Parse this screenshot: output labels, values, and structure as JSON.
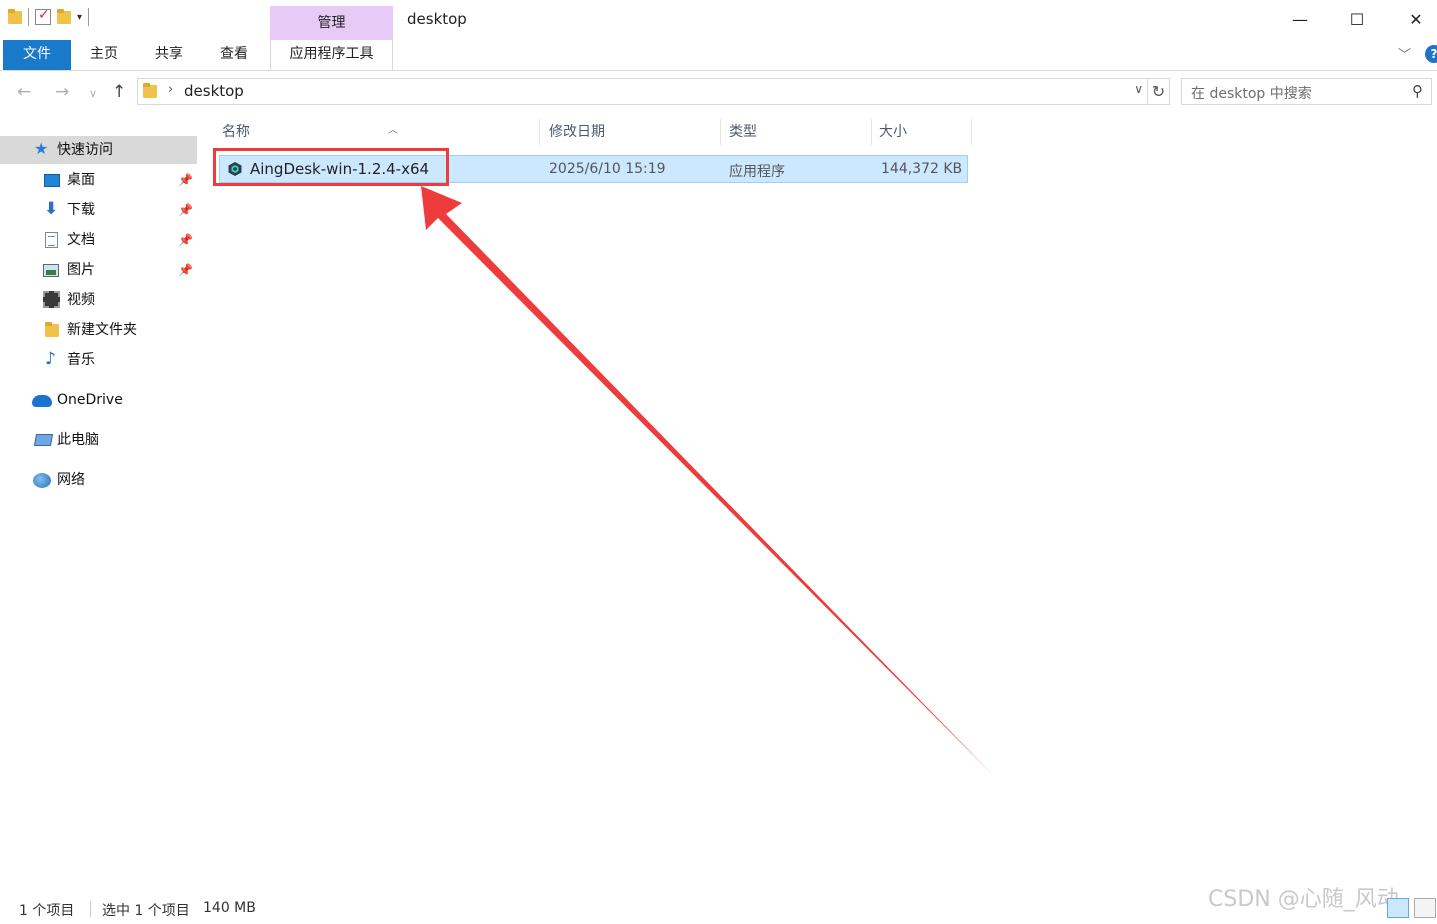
{
  "window": {
    "title": "desktop",
    "context_tab": "管理",
    "controls": {
      "minimize": "—",
      "maximize": "☐",
      "close": "✕"
    }
  },
  "ribbon": {
    "tabs": [
      "文件",
      "主页",
      "共享",
      "查看",
      "应用程序工具"
    ],
    "expand_icon": "chevron-down-icon",
    "help_label": "?"
  },
  "address": {
    "path_segment": "desktop",
    "search_placeholder": "在 desktop 中搜索"
  },
  "nav": {
    "quick_access": "快速访问",
    "items": [
      {
        "label": "桌面",
        "icon": "desktop-icon",
        "pinned": true
      },
      {
        "label": "下载",
        "icon": "download-arrow-icon",
        "pinned": true
      },
      {
        "label": "文档",
        "icon": "document-icon",
        "pinned": true
      },
      {
        "label": "图片",
        "icon": "picture-icon",
        "pinned": true
      },
      {
        "label": "视频",
        "icon": "video-icon",
        "pinned": false
      },
      {
        "label": "新建文件夹",
        "icon": "folder-icon",
        "pinned": false
      },
      {
        "label": "音乐",
        "icon": "music-note-icon",
        "pinned": false
      }
    ],
    "onedrive": "OneDrive",
    "this_pc": "此电脑",
    "network": "网络"
  },
  "columns": {
    "name": "名称",
    "date": "修改日期",
    "type": "类型",
    "size": "大小"
  },
  "files": [
    {
      "name": "AingDesk-win-1.2.4-x64",
      "date": "2025/6/10 15:19",
      "type": "应用程序",
      "size": "144,372 KB",
      "selected": true
    }
  ],
  "status": {
    "item_count": "1 个项目",
    "selection": "选中 1 个项目",
    "selection_size": "140 MB"
  },
  "watermark": "CSDN @心随_风动",
  "colors": {
    "accent": "#1979ca",
    "selection_bg": "#cce8ff",
    "context_tab_bg": "#e8caf6",
    "annotation_red": "#ee3b3b"
  }
}
